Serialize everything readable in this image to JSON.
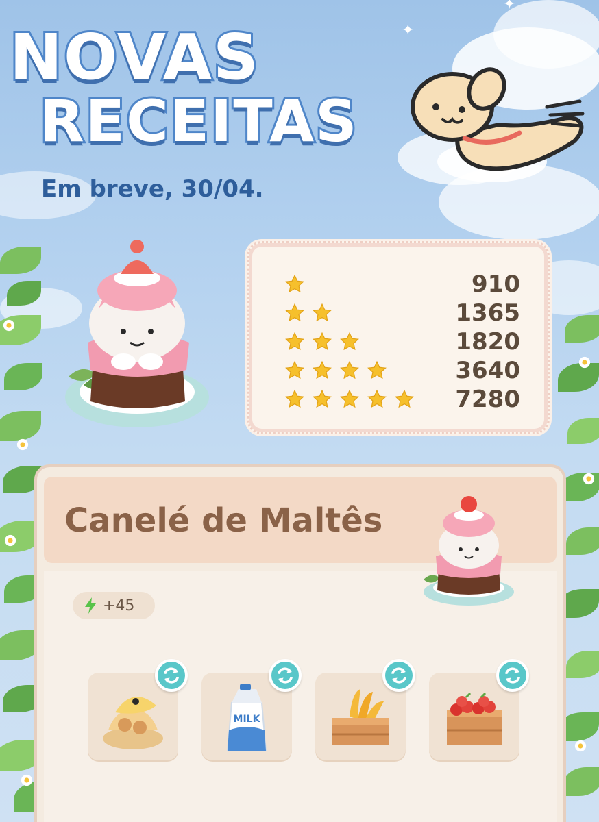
{
  "title": {
    "line1": "NOVAS",
    "line2": "RECEITAS",
    "subtitle": "Em breve, 30/04."
  },
  "star_rewards": [
    {
      "stars": 1,
      "value": "910"
    },
    {
      "stars": 2,
      "value": "1365"
    },
    {
      "stars": 3,
      "value": "1820"
    },
    {
      "stars": 4,
      "value": "3640"
    },
    {
      "stars": 5,
      "value": "7280"
    }
  ],
  "recipe": {
    "name": "Canelé de Maltês",
    "energy": "+45",
    "ingredients": [
      {
        "icon": "egg-icon"
      },
      {
        "icon": "milk-carton-icon",
        "label": "MILK"
      },
      {
        "icon": "banana-crate-icon"
      },
      {
        "icon": "strawberry-crate-icon"
      }
    ]
  },
  "colors": {
    "title_outline": "#4f86c9",
    "subtitle": "#2e5e9b",
    "star": "#f6c02c",
    "swap_button": "#59c7c9",
    "energy": "#58c34a"
  }
}
